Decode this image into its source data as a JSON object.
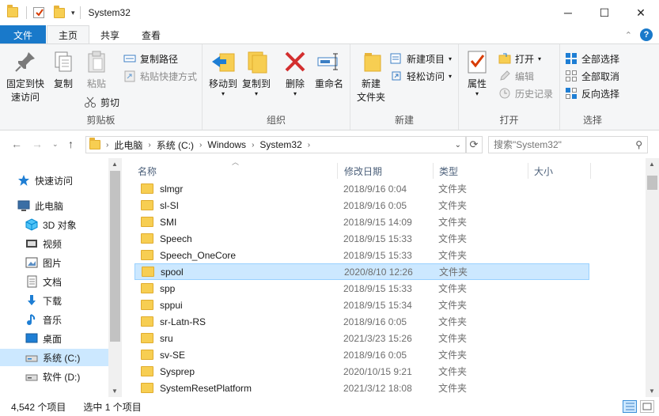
{
  "window": {
    "title": "System32",
    "minimize_glyph": "─",
    "maximize_glyph": "☐",
    "close_glyph": "✕"
  },
  "tabs": {
    "file": "文件",
    "home": "主页",
    "share": "共享",
    "view": "查看"
  },
  "ribbon": {
    "clipboard": {
      "label": "剪贴板",
      "pin": "固定到快\n速访问",
      "copy": "复制",
      "paste": "粘贴",
      "copy_path": "复制路径",
      "paste_shortcut": "粘贴快捷方式",
      "cut": "剪切"
    },
    "organize": {
      "label": "组织",
      "move_to": "移动到",
      "copy_to": "复制到",
      "delete": "删除",
      "rename": "重命名"
    },
    "new": {
      "label": "新建",
      "new_folder": "新建\n文件夹",
      "new_item": "新建项目",
      "easy_access": "轻松访问"
    },
    "open": {
      "label": "打开",
      "properties": "属性",
      "open": "打开",
      "edit": "编辑",
      "history": "历史记录"
    },
    "select": {
      "label": "选择",
      "select_all": "全部选择",
      "select_none": "全部取消",
      "invert": "反向选择"
    }
  },
  "address": {
    "segments": [
      "此电脑",
      "系统 (C:)",
      "Windows",
      "System32"
    ],
    "search_placeholder": "搜索\"System32\""
  },
  "sidebar": {
    "items": [
      {
        "label": "快速访问",
        "icon": "star-icon"
      },
      {
        "label": "此电脑",
        "icon": "computer-icon"
      },
      {
        "label": "3D 对象",
        "icon": "3d-objects-icon"
      },
      {
        "label": "视频",
        "icon": "video-icon"
      },
      {
        "label": "图片",
        "icon": "pictures-icon"
      },
      {
        "label": "文档",
        "icon": "documents-icon"
      },
      {
        "label": "下载",
        "icon": "download-icon"
      },
      {
        "label": "音乐",
        "icon": "music-icon"
      },
      {
        "label": "桌面",
        "icon": "desktop-icon"
      },
      {
        "label": "系统 (C:)",
        "icon": "drive-icon"
      },
      {
        "label": "软件 (D:)",
        "icon": "drive-icon"
      }
    ]
  },
  "columns": {
    "name": "名称",
    "date": "修改日期",
    "type": "类型",
    "size": "大小"
  },
  "files": [
    {
      "name": "slmgr",
      "date": "2018/9/16 0:04",
      "type": "文件夹"
    },
    {
      "name": "sl-SI",
      "date": "2018/9/16 0:05",
      "type": "文件夹"
    },
    {
      "name": "SMI",
      "date": "2018/9/15 14:09",
      "type": "文件夹"
    },
    {
      "name": "Speech",
      "date": "2018/9/15 15:33",
      "type": "文件夹"
    },
    {
      "name": "Speech_OneCore",
      "date": "2018/9/15 15:33",
      "type": "文件夹"
    },
    {
      "name": "spool",
      "date": "2020/8/10 12:26",
      "type": "文件夹"
    },
    {
      "name": "spp",
      "date": "2018/9/15 15:33",
      "type": "文件夹"
    },
    {
      "name": "sppui",
      "date": "2018/9/15 15:34",
      "type": "文件夹"
    },
    {
      "name": "sr-Latn-RS",
      "date": "2018/9/16 0:05",
      "type": "文件夹"
    },
    {
      "name": "sru",
      "date": "2021/3/23 15:26",
      "type": "文件夹"
    },
    {
      "name": "sv-SE",
      "date": "2018/9/16 0:05",
      "type": "文件夹"
    },
    {
      "name": "Sysprep",
      "date": "2020/10/15 9:21",
      "type": "文件夹"
    },
    {
      "name": "SystemResetPlatform",
      "date": "2021/3/12 18:08",
      "type": "文件夹"
    }
  ],
  "status": {
    "count": "4,542 个项目",
    "selected": "选中 1 个项目"
  },
  "colors": {
    "accent": "#1979ca",
    "selection": "#cce8ff",
    "folder": "#f7ce52"
  }
}
